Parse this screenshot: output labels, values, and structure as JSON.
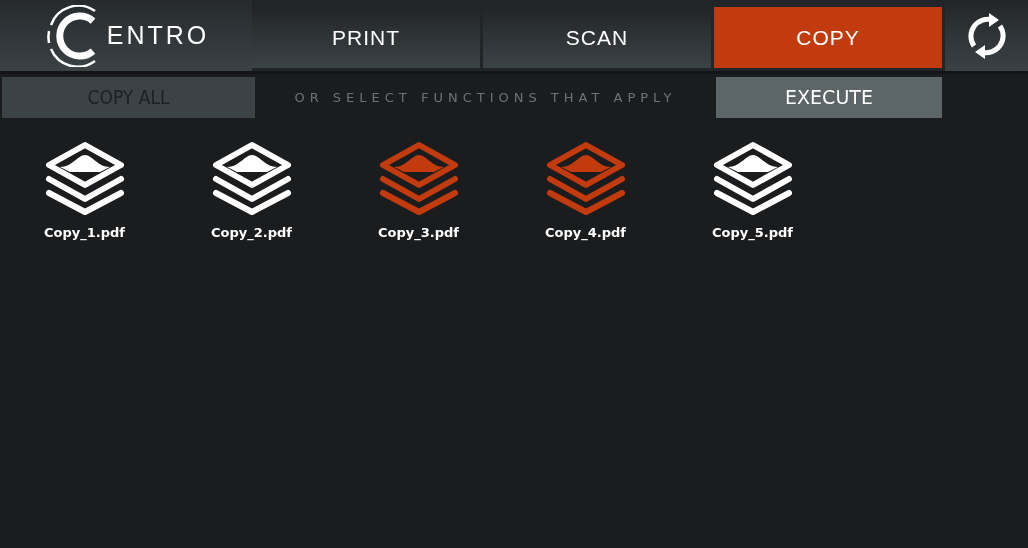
{
  "logo": {
    "text": "ENTRO"
  },
  "tabs": [
    {
      "label": "PRINT",
      "selected": false
    },
    {
      "label": "SCAN",
      "selected": false
    },
    {
      "label": "COPY",
      "selected": true
    }
  ],
  "toolbar": {
    "copy_all": "COPY ALL",
    "hint": "OR SELECT FUNCTIONS THAT APPLY",
    "execute": "EXECUTE"
  },
  "files": [
    {
      "name": "Copy_1.pdf",
      "selected": false
    },
    {
      "name": "Copy_2.pdf",
      "selected": false
    },
    {
      "name": "Copy_3.pdf",
      "selected": true
    },
    {
      "name": "Copy_4.pdf",
      "selected": true
    },
    {
      "name": "Copy_5.pdf",
      "selected": false
    }
  ]
}
